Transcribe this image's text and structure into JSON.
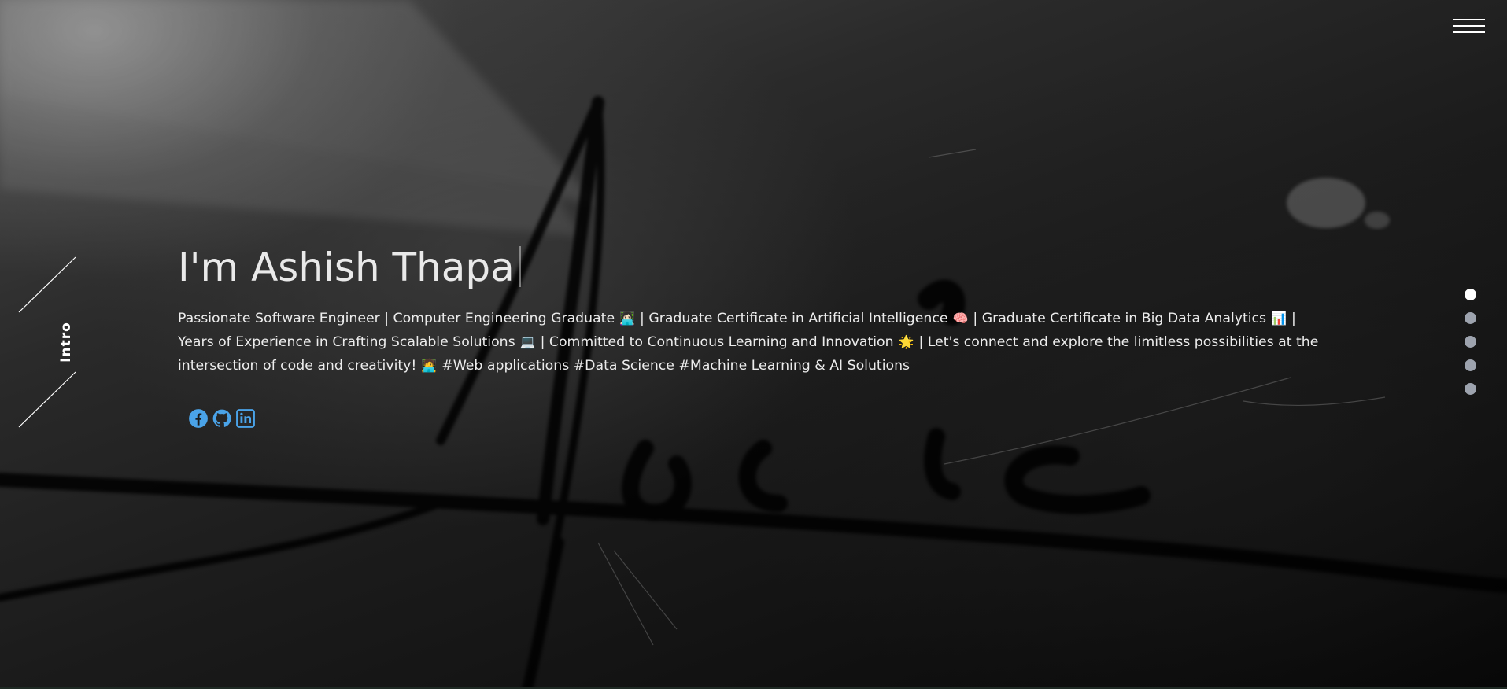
{
  "menu": {
    "icon": "hamburger-menu-icon"
  },
  "sidebar": {
    "section_label": "Intro"
  },
  "hero": {
    "title": "I'm Ashish Thapa",
    "description_parts": {
      "p1": "Passionate Software Engineer | Computer Engineering Graduate",
      "e1": "👩🏻‍💻",
      "p2": "| Graduate Certificate in Artificial Intelligence",
      "e2": "🧠",
      "p3": "| Graduate Certificate in Big Data Analytics",
      "e3": "📊",
      "p4": "| Years of Experience in Crafting Scalable Solutions",
      "e4": "💻",
      "p5": "| Committed to Continuous Learning and Innovation",
      "e5": "🌟",
      "p6": "| Let's connect and explore the limitless possibilities at the intersection of code and creativity!",
      "e6": "🧑‍💻",
      "p7": "#Web applications #Data Science #Machine Learning & AI Solutions"
    }
  },
  "social": [
    {
      "name": "facebook-icon",
      "color": "#4aa3e8"
    },
    {
      "name": "github-icon",
      "color": "#4aa3e8"
    },
    {
      "name": "linkedin-icon",
      "color": "#4aa3e8"
    }
  ],
  "section_dots": {
    "count": 5,
    "active_index": 0
  },
  "colors": {
    "accent": "#4aa3e8",
    "dot_inactive": "#9da3ae",
    "dot_active": "#ffffff"
  }
}
